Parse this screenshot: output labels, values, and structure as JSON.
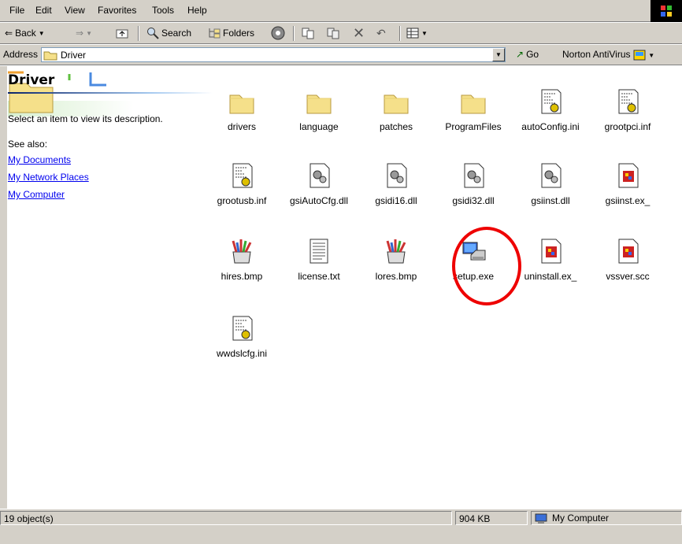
{
  "menu": [
    "File",
    "Edit",
    "View",
    "Favorites",
    "Tools",
    "Help"
  ],
  "toolbar": {
    "back": "Back",
    "search": "Search",
    "folders": "Folders"
  },
  "address": {
    "label": "Address",
    "value": "Driver",
    "go": "Go",
    "norton": "Norton AntiVirus"
  },
  "panel": {
    "folder_name": "Driver",
    "description": "Select an item to view its description.",
    "see_also": "See also:",
    "links": [
      "My Documents",
      "My Network Places",
      "My Computer"
    ]
  },
  "files": [
    {
      "name": "drivers",
      "icon": "folder-icon"
    },
    {
      "name": "language",
      "icon": "folder-icon"
    },
    {
      "name": "patches",
      "icon": "folder-icon"
    },
    {
      "name": "ProgramFiles",
      "icon": "folder-icon"
    },
    {
      "name": "autoConfig.ini",
      "icon": "ini-file-icon"
    },
    {
      "name": "grootpci.inf",
      "icon": "inf-file-icon"
    },
    {
      "name": "grootusb.inf",
      "icon": "inf-file-icon"
    },
    {
      "name": "gsiAutoCfg.dll",
      "icon": "dll-file-icon"
    },
    {
      "name": "gsidi16.dll",
      "icon": "dll-file-icon"
    },
    {
      "name": "gsidi32.dll",
      "icon": "dll-file-icon"
    },
    {
      "name": "gsiinst.dll",
      "icon": "dll-file-icon"
    },
    {
      "name": "gsiinst.ex_",
      "icon": "generic-file-icon"
    },
    {
      "name": "hires.bmp",
      "icon": "bmp-file-icon"
    },
    {
      "name": "license.txt",
      "icon": "text-file-icon"
    },
    {
      "name": "lores.bmp",
      "icon": "bmp-file-icon"
    },
    {
      "name": "setup.exe",
      "icon": "setup-exe-icon"
    },
    {
      "name": "uninstall.ex_",
      "icon": "generic-file-icon"
    },
    {
      "name": "vssver.scc",
      "icon": "generic-file-icon"
    },
    {
      "name": "wwdslcfg.ini",
      "icon": "ini-file-icon"
    }
  ],
  "status": {
    "count": "19 object(s)",
    "size": "904 KB",
    "zone": "My Computer"
  },
  "colors": {
    "chrome": "#d4d0c8",
    "folder": "#f5e08a",
    "highlight": "#e00000",
    "link": "#0000ee"
  }
}
